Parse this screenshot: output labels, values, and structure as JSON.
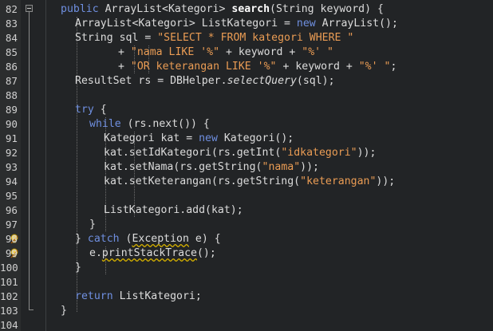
{
  "editor": {
    "lines": [
      {
        "num": "82",
        "tokens": [
          {
            "t": "public",
            "c": "kw"
          },
          {
            "t": " ArrayList<Kategori> "
          },
          {
            "t": "search",
            "c": "fn-bold"
          },
          {
            "t": "(String keyword) {"
          }
        ]
      },
      {
        "num": "83",
        "tokens": [
          {
            "t": "ArrayList<Kategori> ListKategori = "
          },
          {
            "t": "new",
            "c": "kw"
          },
          {
            "t": " ArrayList();"
          }
        ]
      },
      {
        "num": "84",
        "tokens": [
          {
            "t": "String sql = "
          },
          {
            "t": "\"SELECT * FROM kategori WHERE \"",
            "c": "str"
          }
        ]
      },
      {
        "num": "85",
        "tokens": [
          {
            "t": "+ "
          },
          {
            "t": "\"nama LIKE '%\"",
            "c": "str"
          },
          {
            "t": " + keyword + "
          },
          {
            "t": "\"%' \"",
            "c": "str"
          }
        ]
      },
      {
        "num": "86",
        "tokens": [
          {
            "t": "+ "
          },
          {
            "t": "\"OR keterangan LIKE '%\"",
            "c": "str"
          },
          {
            "t": " + keyword + "
          },
          {
            "t": "\"%' \"",
            "c": "str"
          },
          {
            "t": ";"
          }
        ]
      },
      {
        "num": "87",
        "tokens": [
          {
            "t": "ResultSet rs = DBHelper."
          },
          {
            "t": "selectQuery",
            "c": "ital"
          },
          {
            "t": "(sql);"
          }
        ]
      },
      {
        "num": "88",
        "tokens": []
      },
      {
        "num": "89",
        "tokens": [
          {
            "t": "try",
            "c": "kw"
          },
          {
            "t": " {"
          }
        ]
      },
      {
        "num": "90",
        "tokens": [
          {
            "t": "while",
            "c": "kw"
          },
          {
            "t": " (rs.next()) {"
          }
        ]
      },
      {
        "num": "91",
        "tokens": [
          {
            "t": "Kategori kat = "
          },
          {
            "t": "new",
            "c": "kw"
          },
          {
            "t": " Kategori();"
          }
        ]
      },
      {
        "num": "92",
        "tokens": [
          {
            "t": "kat.setIdKategori(rs.getInt("
          },
          {
            "t": "\"idkategori\"",
            "c": "str"
          },
          {
            "t": "));"
          }
        ]
      },
      {
        "num": "93",
        "tokens": [
          {
            "t": "kat.setNama(rs.getString("
          },
          {
            "t": "\"nama\"",
            "c": "str"
          },
          {
            "t": "));"
          }
        ]
      },
      {
        "num": "94",
        "tokens": [
          {
            "t": "kat.setKeterangan(rs.getString("
          },
          {
            "t": "\"keterangan\"",
            "c": "str"
          },
          {
            "t": "));"
          }
        ]
      },
      {
        "num": "95",
        "tokens": []
      },
      {
        "num": "96",
        "tokens": [
          {
            "t": "ListKategori.add(kat);"
          }
        ]
      },
      {
        "num": "97",
        "tokens": [
          {
            "t": "}"
          }
        ]
      },
      {
        "num": "98",
        "tokens": [
          {
            "t": "} "
          },
          {
            "t": "catch",
            "c": "kw"
          },
          {
            "t": " ("
          },
          {
            "t": "Exception",
            "c": "warn-underline"
          },
          {
            "t": " e) {"
          }
        ]
      },
      {
        "num": "99",
        "tokens": [
          {
            "t": "e."
          },
          {
            "t": "printStackTrace",
            "c": "warn-underline"
          },
          {
            "t": "();"
          }
        ]
      },
      {
        "num": "100",
        "tokens": [
          {
            "t": "}"
          }
        ]
      },
      {
        "num": "101",
        "tokens": []
      },
      {
        "num": "102",
        "tokens": [
          {
            "t": "return",
            "c": "kw"
          },
          {
            "t": " ListKategori;"
          }
        ]
      },
      {
        "num": "103",
        "tokens": [
          {
            "t": "}"
          }
        ]
      },
      {
        "num": "104",
        "tokens": []
      }
    ],
    "warning_icon": "lightbulb-warning-icon",
    "fold_icon": "fold-minus-icon"
  }
}
